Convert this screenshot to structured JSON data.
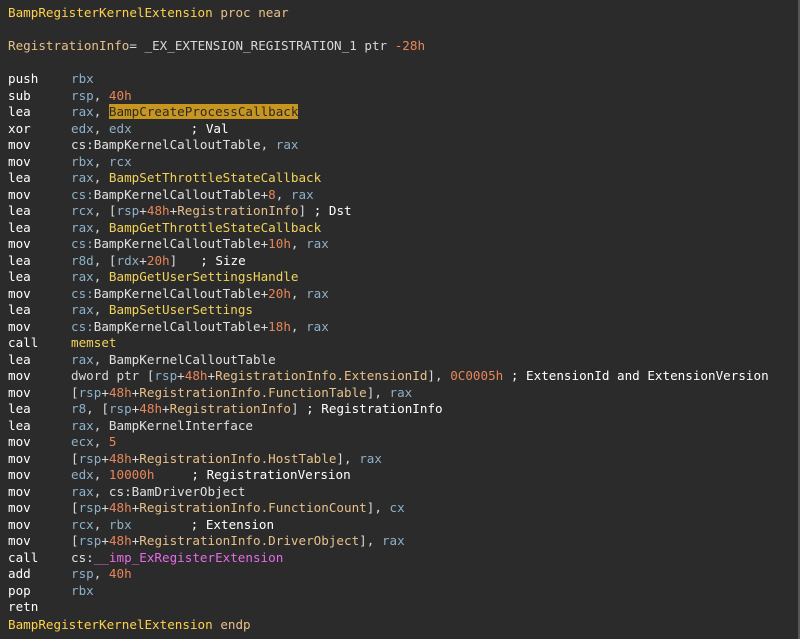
{
  "listing": {
    "proc_name": "BampRegisterKernelExtension",
    "proc_kw": "proc near",
    "var_name": "RegistrationInfo",
    "var_def_rest": "= _EX_EXTENSION_REGISTRATION_1 ptr ",
    "var_offset": "-28h",
    "endp_kw": "endp",
    "mnemonics": {
      "push": "push",
      "sub": "sub",
      "lea": "lea",
      "xor": "xor",
      "mov": "mov",
      "call": "call",
      "add": "add",
      "pop": "pop",
      "retn": "retn"
    },
    "regs": {
      "rbx": "rbx",
      "rsp": "rsp",
      "rax": "rax",
      "edx": "edx",
      "rcx": "rcx",
      "r8d": "r8d",
      "rdx": "rdx",
      "r8": "r8",
      "ecx": "ecx",
      "cx": "cx"
    },
    "nums": {
      "h40": "40h",
      "h8": "8",
      "h48": "48h",
      "h10": "10h",
      "h20": "20h",
      "h18": "18h",
      "imm_ext": "0C0005h",
      "n5": "5",
      "n10000": "10000h"
    },
    "symbols": {
      "create_process_cb": "BampCreateProcessCallback",
      "callout_table": "BampKernelCalloutTable",
      "cs_callout_table": "cs:BampKernelCalloutTable",
      "cs_prefix": "cs:",
      "set_throttle_cb": "BampSetThrottleStateCallback",
      "get_throttle_cb": "BampGetThrottleStateCallback",
      "get_user_settings": "BampGetUserSettingsHandle",
      "set_user_settings": "BampSetUserSettings",
      "memset": "memset",
      "kernel_interface": "BampKernelInterface",
      "cs_driver_object": "cs:BamDriverObject",
      "imp_register": "__imp_ExRegisterExtension"
    },
    "fields": {
      "extension_id": "RegistrationInfo.ExtensionId",
      "function_table": "RegistrationInfo.FunctionTable",
      "host_table": "RegistrationInfo.HostTable",
      "function_count": "RegistrationInfo.FunctionCount",
      "driver_object": "RegistrationInfo.DriverObject"
    },
    "comments": {
      "val": "; Val",
      "dst": "; Dst",
      "size": "; Size",
      "ext_id_ver": "; ExtensionId and ExtensionVersion",
      "reg_info": "; RegistrationInfo",
      "reg_version": "; RegistrationVersion",
      "extension": "; Extension"
    },
    "tokens": {
      "comma": ", ",
      "lb": "[",
      "rb": "]",
      "plus": "+",
      "dword_ptr": "dword ptr "
    }
  }
}
